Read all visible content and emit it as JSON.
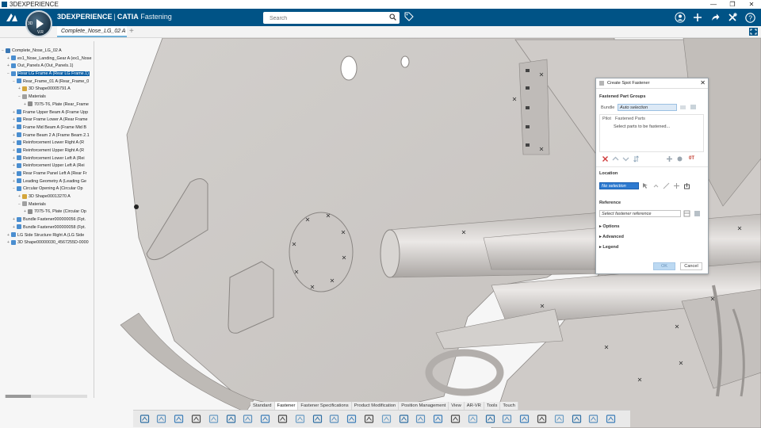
{
  "window": {
    "title": "3DEXPERIENCE",
    "controls": [
      "—",
      "❐",
      "✕"
    ]
  },
  "topbar": {
    "brand": "3DEXPERIENCE",
    "product": "CATIA",
    "app": "Fastening",
    "search_placeholder": "Search",
    "compass": {
      "left": "3D",
      "right": "V.R"
    }
  },
  "tabs": [
    {
      "label": "Complete_Nose_LG_02 A"
    }
  ],
  "tab_add": "+",
  "tree": {
    "items": [
      {
        "label": "Complete_Nose_LG_02 A",
        "expander": "−",
        "icon_color": "#3a78b5",
        "selected": false
      },
      {
        "label": "ex1_Nose_Landing_Gear A (ex1_Nose",
        "expander": "+",
        "icon_color": "#4a8ed0",
        "selected": false
      },
      {
        "label": "Out_Panels A (Out_Panels.1)",
        "expander": "+",
        "icon_color": "#4a8ed0",
        "selected": false
      },
      {
        "label": "Rear LG Frame A (Rear LG Frame.1)",
        "expander": "−",
        "icon_color": "#4a8ed0",
        "selected": true
      },
      {
        "label": "Rear_Frame_01 A (Rear_Frame_0",
        "expander": "−",
        "icon_color": "#4a8ed0",
        "selected": false
      },
      {
        "label": "3D Shape00005791 A",
        "expander": "+",
        "icon_color": "#d4a63b",
        "selected": false
      },
      {
        "label": "Materials",
        "expander": "−",
        "icon_color": "#a0a0a0",
        "selected": false
      },
      {
        "label": "7075-T6, Plate (Rear_Frame",
        "expander": "+",
        "icon_color": "#8c8c8c",
        "selected": false
      },
      {
        "label": "Frame Upper Beam A (Frame Upp",
        "expander": "+",
        "icon_color": "#4a8ed0",
        "selected": false
      },
      {
        "label": "Rear Frame Lower A (Rear Frame",
        "expander": "+",
        "icon_color": "#4a8ed0",
        "selected": false
      },
      {
        "label": "Frame Mid Beam A (Frame Mid B",
        "expander": "+",
        "icon_color": "#4a8ed0",
        "selected": false
      },
      {
        "label": "Frame Beam 2 A (Frame Beam 2.1",
        "expander": "+",
        "icon_color": "#4a8ed0",
        "selected": false
      },
      {
        "label": "Reinforcement Lower Right A (R",
        "expander": "+",
        "icon_color": "#4a8ed0",
        "selected": false
      },
      {
        "label": "Reinforcement Upper Right A (R",
        "expander": "+",
        "icon_color": "#4a8ed0",
        "selected": false
      },
      {
        "label": "Reinforcement Lower Left A (Rei",
        "expander": "+",
        "icon_color": "#4a8ed0",
        "selected": false
      },
      {
        "label": "Reinforcement Upper Left A (Rei",
        "expander": "+",
        "icon_color": "#4a8ed0",
        "selected": false
      },
      {
        "label": "Rear Frame Panel Left A (Rear Fr",
        "expander": "+",
        "icon_color": "#4a8ed0",
        "selected": false
      },
      {
        "label": "Leading Geometry A (Leading Ge",
        "expander": "+",
        "icon_color": "#4a8ed0",
        "selected": false
      },
      {
        "label": "Circular Opening A (Circular Op",
        "expander": "−",
        "icon_color": "#4a8ed0",
        "selected": false
      },
      {
        "label": "3D Shape00013270 A",
        "expander": "+",
        "icon_color": "#d4a63b",
        "selected": false
      },
      {
        "label": "Materials",
        "expander": "−",
        "icon_color": "#a0a0a0",
        "selected": false
      },
      {
        "label": "7075-T6, Plate (Circular Op",
        "expander": "+",
        "icon_color": "#8c8c8c",
        "selected": false
      },
      {
        "label": "Bundle Fastener000000056 (Fpt.",
        "expander": "+",
        "icon_color": "#4a8ed0",
        "selected": false
      },
      {
        "label": "Bundle Fastener000000058 (Fpt.",
        "expander": "+",
        "icon_color": "#4a8ed0",
        "selected": false
      },
      {
        "label": "LG Side Structure Right A (LG Side",
        "expander": "+",
        "icon_color": "#4a8ed0",
        "selected": false
      },
      {
        "label": "3D Shape00000030_4567255D-0000",
        "expander": "+",
        "icon_color": "#4a8ed0",
        "selected": false
      }
    ],
    "indents": [
      0,
      1,
      1,
      1,
      2,
      3,
      3,
      4,
      2,
      2,
      2,
      2,
      2,
      2,
      2,
      2,
      2,
      2,
      2,
      3,
      3,
      4,
      2,
      2,
      1,
      1
    ]
  },
  "dialog": {
    "title": "Create Spot Fastener",
    "close": "✕",
    "fastened_part_groups": "Fastened Part Groups",
    "bundle_label": "Bundle",
    "bundle_value": "Auto selection",
    "pilot_label": "Pilot",
    "pilot_value": "Fastened Parts",
    "hint": "Select parts to be fastened...",
    "ot_label": "0T",
    "location_label": "Location",
    "location_value": "No selection",
    "reference_label": "Reference",
    "reference_placeholder": "Select fastener reference",
    "options": "Options",
    "advanced": "Advanced",
    "legend": "Legend",
    "ok": "OK",
    "cancel": "Cancel"
  },
  "section_tabs": [
    {
      "label": "Standard",
      "active": false
    },
    {
      "label": "Fastener",
      "active": true
    },
    {
      "label": "Fastener Specifications",
      "active": false
    },
    {
      "label": "Product Modification",
      "active": false
    },
    {
      "label": "Position Management",
      "active": false
    },
    {
      "label": "View",
      "active": false
    },
    {
      "label": "AR-VR",
      "active": false
    },
    {
      "label": "Tools",
      "active": false
    },
    {
      "label": "Touch",
      "active": false
    }
  ],
  "toolbar_icons": [
    "cut-icon",
    "copy-icon",
    "paste-icon",
    "undo-icon",
    "zoom-icon",
    "book-icon",
    "select-icon",
    "product-icon",
    "part-icon",
    "pen-icon",
    "spot-fastener-icon",
    "fastener-icon",
    "bundle-icon",
    "flange-icon",
    "robot-icon",
    "joint-icon",
    "rivet-icon",
    "assembly-icon",
    "weld-icon",
    "dot-icon",
    "pin-icon",
    "clamp-icon",
    "table-icon",
    "view-icon",
    "grid-icon",
    "filter-icon",
    "settings-icon",
    "tools-icon"
  ],
  "colors": {
    "brand_blue": "#005386",
    "model_gray": "#cfcbc8",
    "selection_blue": "#0a5fa6"
  }
}
